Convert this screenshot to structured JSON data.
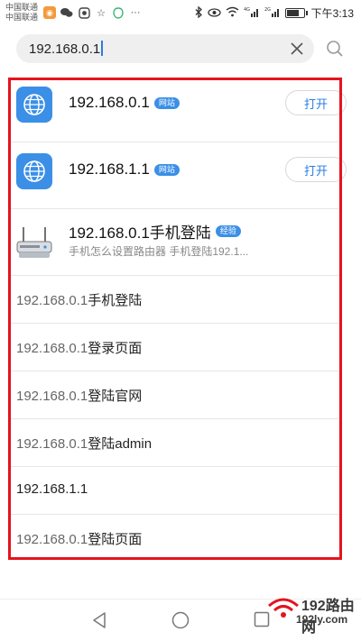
{
  "status_bar": {
    "carrier_1": "中国联通",
    "carrier_2": "中国联通",
    "network_label_1": "4G",
    "network_label_2": "2G",
    "battery_level": 0.75,
    "time": "下午3:13"
  },
  "search": {
    "query": "192.168.0.1"
  },
  "results": {
    "apps": [
      {
        "title": "192.168.0.1",
        "tag": "网站",
        "button": "打开"
      },
      {
        "title": "192.168.1.1",
        "tag": "网站",
        "button": "打开"
      }
    ],
    "experience": {
      "title": "192.168.0.1手机登陆",
      "tag": "经验",
      "description": "手机怎么设置路由器 手机登陆192.1..."
    },
    "suggestions": [
      {
        "highlight": "192.168.0.1",
        "rest": "手机登陆"
      },
      {
        "highlight": "192.168.0.1",
        "rest": "登录页面"
      },
      {
        "highlight": "192.168.0.1",
        "rest": "登陆官网"
      },
      {
        "highlight": "192.168.0.1",
        "rest": "登陆admin"
      },
      {
        "highlight": "",
        "rest": "192.168.1.1"
      },
      {
        "highlight": "192.168.0.1",
        "rest": "登陆页面"
      }
    ]
  },
  "watermark": {
    "title": "192路由网",
    "url": "192ly.com"
  },
  "colors": {
    "accent": "#3b8fe6",
    "highlight_frame": "#e4141e",
    "link_blue": "#2a7de1"
  }
}
